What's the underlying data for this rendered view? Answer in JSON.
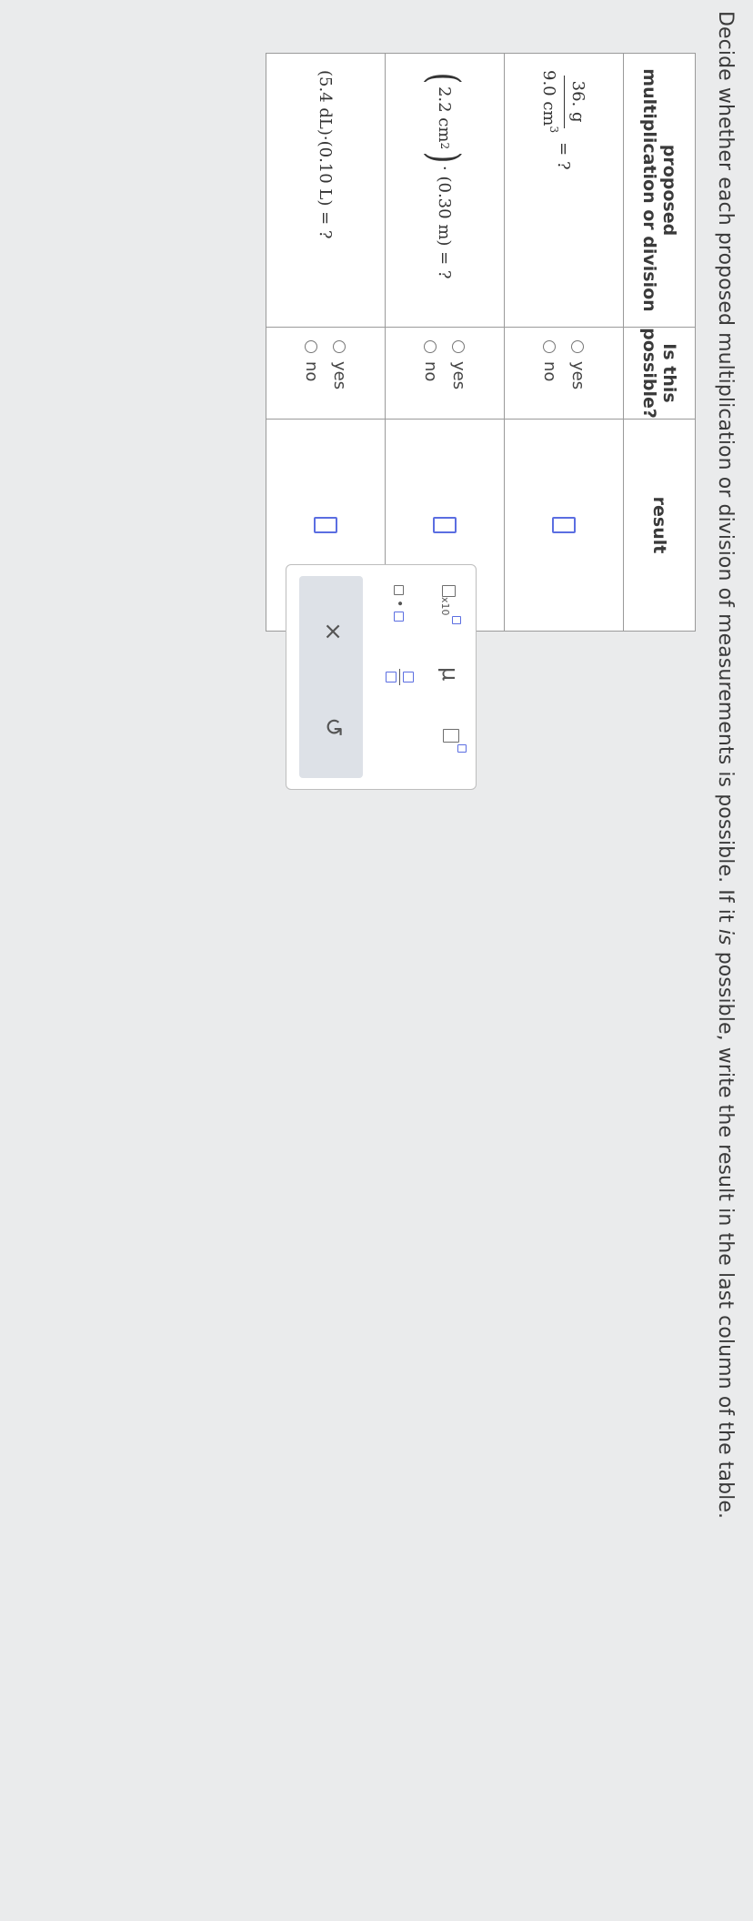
{
  "instructions": {
    "part1": "Decide whether each proposed multiplication or division of measurements is possible. If it ",
    "emph": "is",
    "part2": " possible, write the result in the last column of the table."
  },
  "table": {
    "headers": {
      "col1_line1": "proposed",
      "col1_line2": "multiplication or division",
      "col2_line1": "Is this",
      "col2_line2": "possible?",
      "col3": "result"
    },
    "rows": [
      {
        "numerator": "36. g",
        "denominator_value": "9.0 cm",
        "denominator_exp": "3",
        "tail": "= ?",
        "yes": "yes",
        "no": "no"
      },
      {
        "paren_left": "(",
        "base": "2.2 cm",
        "exp": "2",
        "paren_right": ")",
        "rest": "· (0.30 m) = ?",
        "yes": "yes",
        "no": "no"
      },
      {
        "expr": "(5.4 dL)·(0.10 L) = ?",
        "yes": "yes",
        "no": "no"
      }
    ]
  },
  "toolbox": {
    "x10": "x10",
    "mu": "μ",
    "dot": "•",
    "clear": "×",
    "undo": "↺"
  },
  "colors": {
    "accent": "#5b6ee1",
    "background": "#eaebec"
  }
}
